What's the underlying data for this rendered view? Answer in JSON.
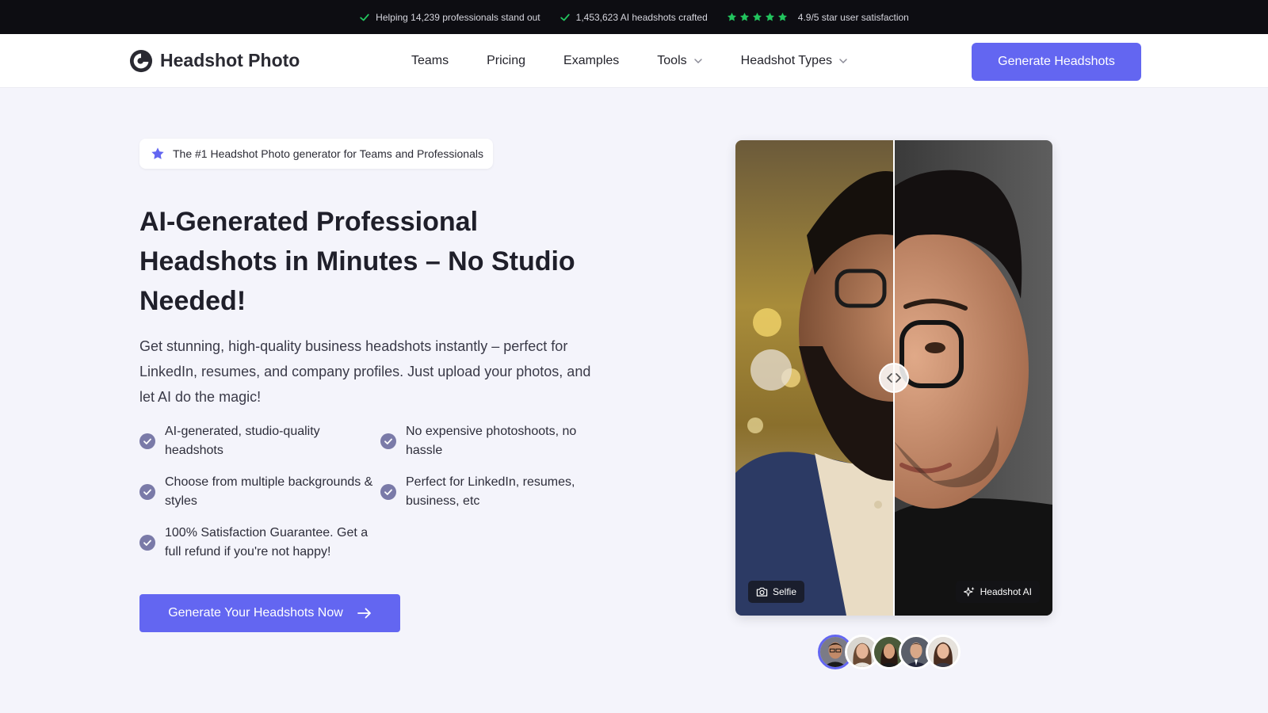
{
  "topbar": {
    "items": [
      {
        "text": "Helping 14,239 professionals stand out",
        "icon": "check-icon"
      },
      {
        "text": "1,453,623 AI headshots crafted",
        "icon": "check-icon"
      },
      {
        "text": "4.9/5 star user satisfaction",
        "icon": "star-icon",
        "stars": 5
      }
    ],
    "accent": "#22c55e"
  },
  "header": {
    "logo_text": "Headshot Photo",
    "nav": [
      {
        "label": "Teams",
        "dropdown": false
      },
      {
        "label": "Pricing",
        "dropdown": false
      },
      {
        "label": "Examples",
        "dropdown": false
      },
      {
        "label": "Tools",
        "dropdown": true
      },
      {
        "label": "Headshot Types",
        "dropdown": true
      }
    ],
    "cta_label": "Generate Headshots"
  },
  "hero": {
    "badge": "The #1 Headshot Photo generator for Teams and Professionals",
    "title": "AI-Generated Professional Headshots in Minutes – No Studio Needed!",
    "lead": "Get stunning, high-quality business headshots instantly – perfect for LinkedIn, resumes, and company profiles. Just upload your photos, and let AI do the magic!",
    "features": [
      "AI-generated, studio-quality headshots",
      "No expensive photoshoots, no hassle",
      "Choose from multiple backgrounds & styles",
      "Perfect for LinkedIn, resumes, business, etc",
      "100% Satisfaction Guarantee. Get a full refund if you're not happy!"
    ],
    "cta_label": "Generate Your Headshots Now"
  },
  "compare": {
    "left_label": "Selfie",
    "right_label": "Headshot AI",
    "slider_position": 0.5
  },
  "colors": {
    "brand": "#6366f1",
    "topbar_bg": "#0d0d12",
    "page_bg": "#f4f4fb"
  }
}
